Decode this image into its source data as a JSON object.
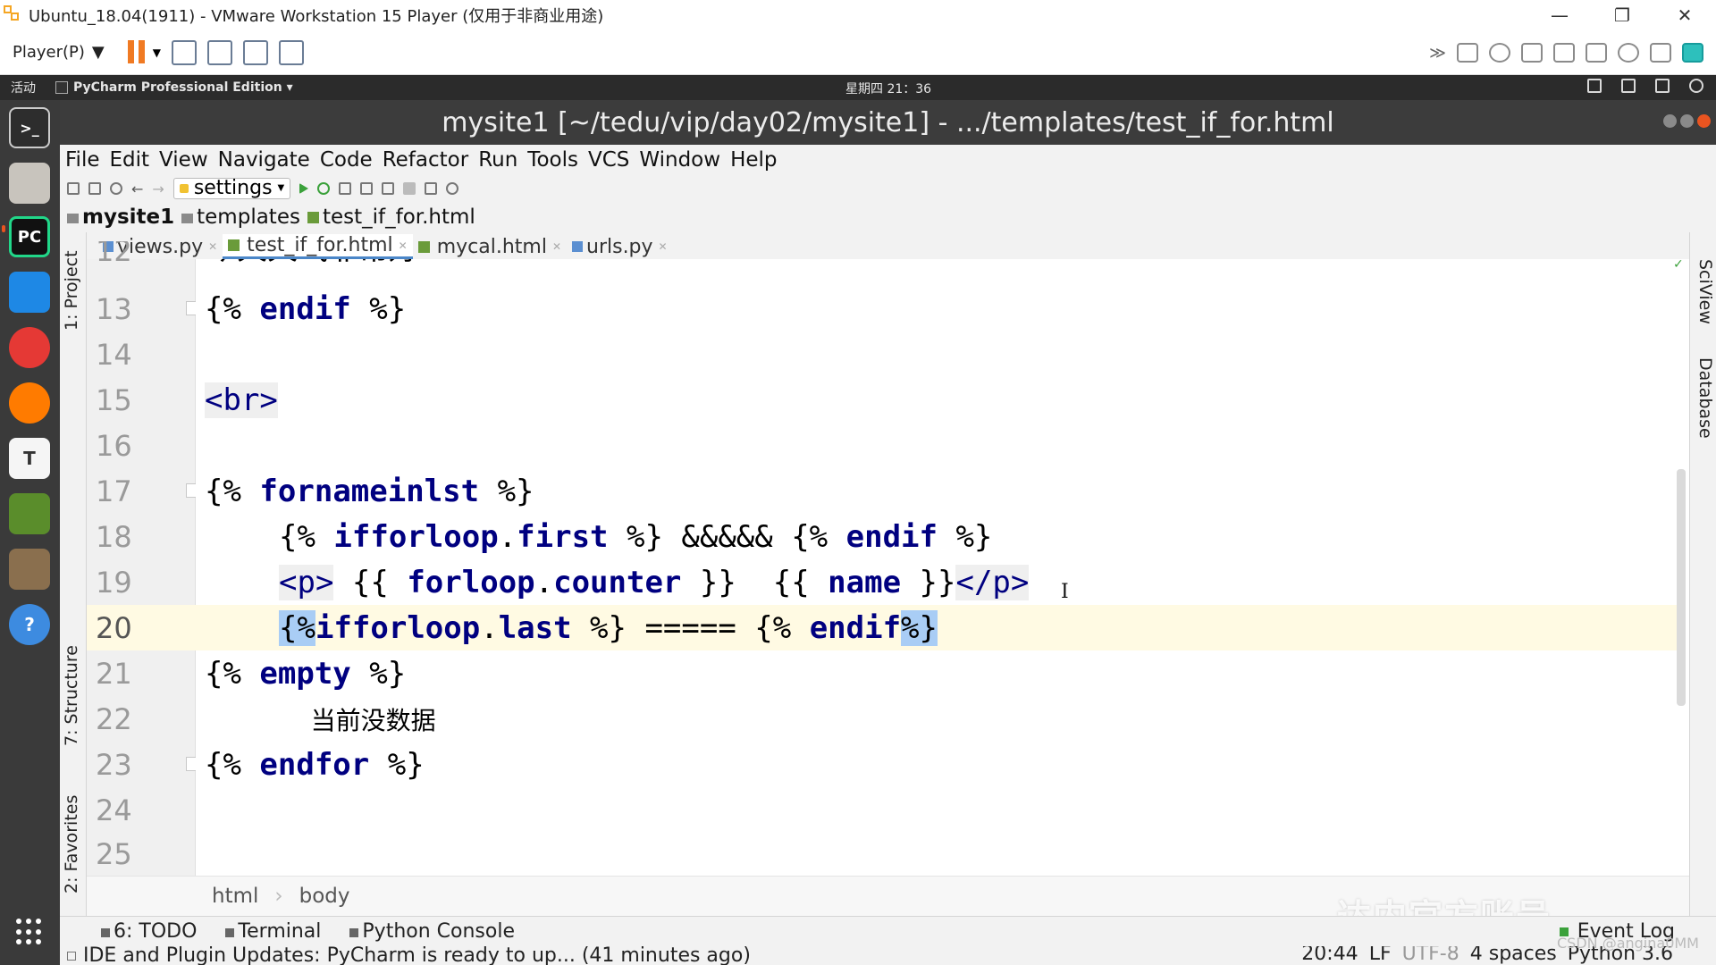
{
  "vm": {
    "title": "Ubuntu_18.04(1911) - VMware Workstation 15 Player (仅用于非商业用途)",
    "player_menu": "Player(P)",
    "min": "—",
    "restore": "❐",
    "close": "✕"
  },
  "ubuntu": {
    "activities": "活动",
    "app_name": "PyCharm Professional Edition ▾",
    "clock": "星期四 21：36"
  },
  "dock": {
    "items": [
      "terminal",
      "files",
      "pycharm",
      "vscode",
      "chrome",
      "firefox",
      "typora",
      "book",
      "gimp",
      "help"
    ]
  },
  "pycharm": {
    "window_title": "mysite1 [~/tedu/vip/day02/mysite1] - .../templates/test_if_for.html",
    "menu": [
      "File",
      "Edit",
      "View",
      "Navigate",
      "Code",
      "Refactor",
      "Run",
      "Tools",
      "VCS",
      "Window",
      "Help"
    ],
    "run_config": "settings",
    "breadcrumb": [
      "mysite1",
      "templates",
      "test_if_for.html"
    ],
    "tabs": [
      {
        "label": "views.py",
        "active": false
      },
      {
        "label": "test_if_for.html",
        "active": true
      },
      {
        "label": "mycal.html",
        "active": false
      },
      {
        "label": "urls.py",
        "active": false
      }
    ],
    "left_tools": [
      "1: Project",
      "7: Structure",
      "2: Favorites"
    ],
    "right_tools": [
      "SciView",
      "Database"
    ],
    "editor_breadcrumb": [
      "html",
      "body"
    ],
    "bottom_tabs": [
      "6: TODO",
      "Terminal",
      "Python Console"
    ],
    "event_log": "Event Log",
    "status_message": "IDE and Plugin Updates: PyCharm is ready to up... (41 minutes ago)",
    "status_right": [
      "20:44",
      "LF",
      "UTF-8",
      "4 spaces",
      "Python 3.6"
    ]
  },
  "code": {
    "current_line": 20,
    "lines": [
      {
        "n": "12",
        "text": "今天天气非常好"
      },
      {
        "n": "13",
        "text": "{% endif %}"
      },
      {
        "n": "14",
        "text": ""
      },
      {
        "n": "15",
        "text": "<br>"
      },
      {
        "n": "16",
        "text": ""
      },
      {
        "n": "17",
        "text": "{% for name in lst %}"
      },
      {
        "n": "18",
        "text": "    {% if forloop.first %} &&&&& {% endif %}"
      },
      {
        "n": "19",
        "text": "    <p> {{ forloop.counter }}  {{ name }}</p>"
      },
      {
        "n": "20",
        "text": "    {% if forloop.last %} ===== {% endif %}"
      },
      {
        "n": "21",
        "text": "{% empty %}"
      },
      {
        "n": "22",
        "text": "    当前没数据"
      },
      {
        "n": "23",
        "text": "{% endfor %}"
      },
      {
        "n": "24",
        "text": ""
      },
      {
        "n": "25",
        "text": ""
      }
    ]
  },
  "watermark": "达内官方账号",
  "csdn": "CSDN @angina0MM"
}
